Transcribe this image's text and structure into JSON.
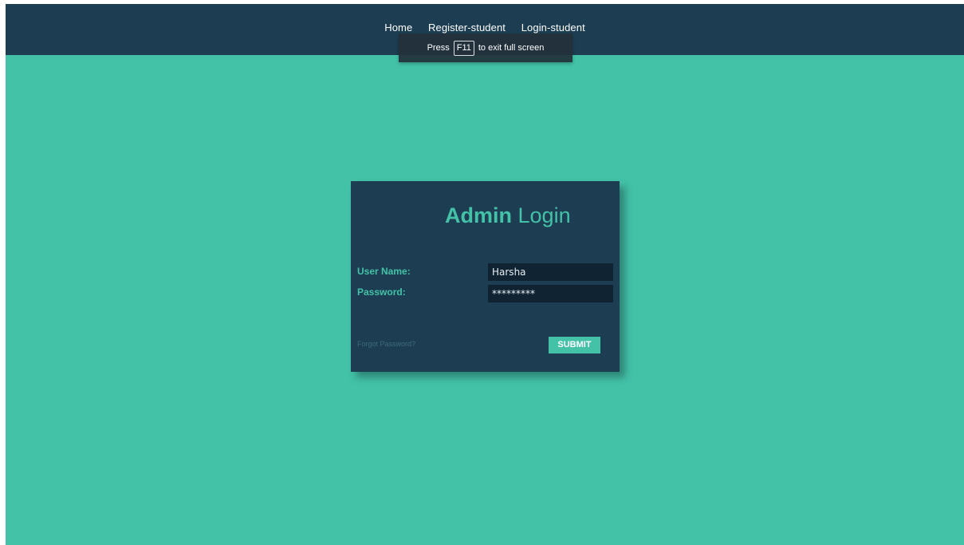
{
  "nav": {
    "items": [
      {
        "label": "Home"
      },
      {
        "label": "Register-student"
      },
      {
        "label": "Login-student"
      }
    ]
  },
  "fullscreen_notice": {
    "prefix": "Press",
    "key": "F11",
    "suffix": "to exit full screen"
  },
  "login": {
    "title_bold": "Admin",
    "title_light": "Login",
    "username_label": "User Name:",
    "username_value": "Harsha",
    "password_label": "Password:",
    "password_value": "*********",
    "forgot_label": "Forgot Password?",
    "submit_label": "SUBMIT"
  },
  "colors": {
    "page_background": "#43c2a8",
    "navbar": "#1d3e52",
    "card": "#1d3e52",
    "accent": "#43c2a8",
    "input_background": "#0f2333"
  }
}
